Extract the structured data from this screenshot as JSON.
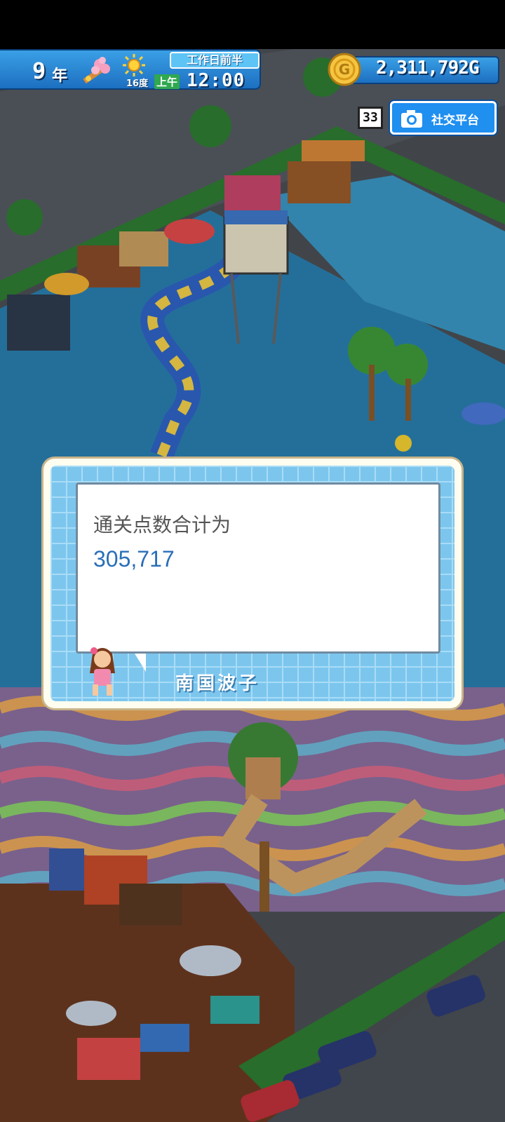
{
  "hud": {
    "year_number": "9",
    "year_unit": "年",
    "temperature": "16度",
    "workday_period": "工作日前半",
    "am_pm": "上午",
    "time": "12:00",
    "money": "2,311,792G",
    "badge_number": "33",
    "social_label": "社交平台"
  },
  "dialog": {
    "line1": "通关点数合计为",
    "line2": "305,717",
    "speaker": "南国波子"
  },
  "icons": [
    "flower-icon",
    "sun-icon",
    "coin-icon",
    "camera-icon"
  ],
  "colors": {
    "hud_blue": "#1d6fc0",
    "dialog_number": "#2a6fb8",
    "pool_water": "#2a7fb0"
  }
}
